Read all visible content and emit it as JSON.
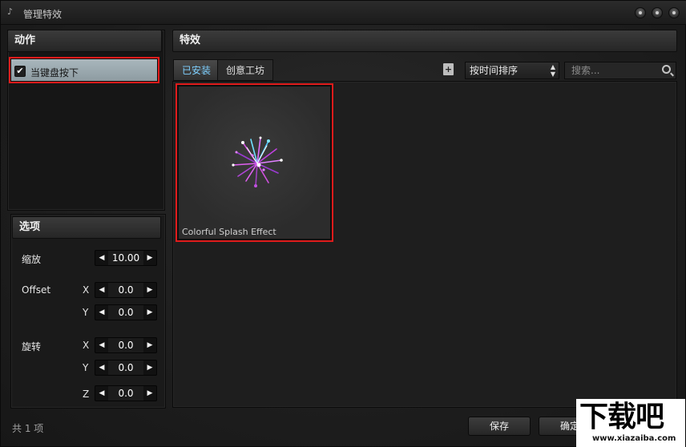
{
  "window": {
    "title": "管理特效",
    "app_icon": "♪"
  },
  "actions_panel": {
    "header": "动作",
    "item": {
      "label": "当键盘按下",
      "checked": true
    }
  },
  "effects_panel": {
    "header": "特效",
    "tabs": [
      {
        "label": "已安装",
        "active": true
      },
      {
        "label": "创意工坊",
        "active": false
      }
    ],
    "add_icon": "+",
    "sort_value": "按时间排序",
    "search_placeholder": "搜索...",
    "effects": [
      {
        "name": "Colorful Splash Effect"
      }
    ]
  },
  "options_panel": {
    "header": "选项",
    "scale": {
      "label": "缩放",
      "value": "10.00"
    },
    "offset": {
      "label": "Offset",
      "x_label": "X",
      "x": "0.0",
      "y_label": "Y",
      "y": "0.0"
    },
    "rotation": {
      "label": "旋转",
      "x_label": "X",
      "x": "0.0",
      "y_label": "Y",
      "y": "0.0",
      "z_label": "Z",
      "z": "0.0"
    },
    "arrow_left": "◀",
    "arrow_right": "▶"
  },
  "footer": {
    "count": "共 1 项",
    "save": "保存",
    "ok": "确定"
  },
  "watermark": {
    "main": "下载吧",
    "url": "www.xiazaiba.com"
  },
  "colors": {
    "highlight": "#e01b1b",
    "tab_active_text": "#7fd0ff",
    "selected_item": "#a9b7bd"
  }
}
